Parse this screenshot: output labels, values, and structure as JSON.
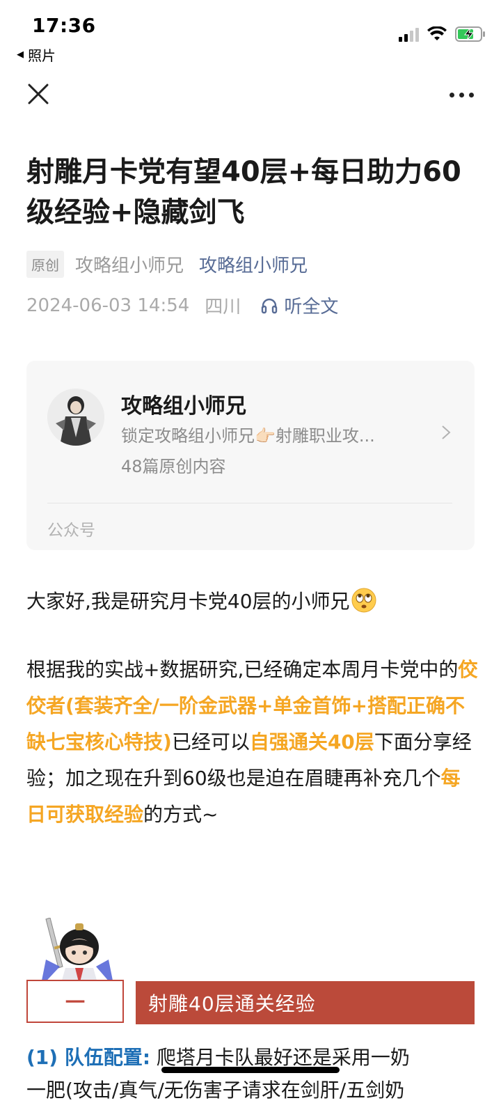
{
  "status_bar": {
    "time": "17:36",
    "back_app": "照片",
    "back_icon": "back-triangle-icon",
    "icons": [
      "signal-icon",
      "wifi-icon",
      "battery-charging-icon"
    ],
    "battery_color": "#34c759"
  },
  "nav": {
    "close_icon": "close-icon",
    "more_icon": "more-icon"
  },
  "article": {
    "title": "射雕月卡党有望40层+每日助力60级经验+隐藏剑飞",
    "original_tag": "原创",
    "author": "攻略组小师兄",
    "account_link": "攻略组小师兄",
    "date": "2024-06-03 14:54",
    "location": "四川",
    "listen_label": "听全文"
  },
  "account_card": {
    "name": "攻略组小师兄",
    "description": "锁定攻略组小师兄👉🏻射雕职业攻...",
    "count": "48篇原创内容",
    "footer": "公众号"
  },
  "body": {
    "p1": "大家好,我是研究月卡党40层的小师兄",
    "p2_a": "根据我的实战+数据研究,已经确定本周月卡党中的",
    "p2_hl1": "佼佼者(套装齐全/一阶金武器+单金首饰+搭配正确不缺七宝核心特技)",
    "p2_b": "已经可以",
    "p2_hl2": "自强通关40层",
    "p2_c": "下面分享经验；加之现在升到60级也是迫在眉睫再补充几个",
    "p2_hl3": "每日可获取经验",
    "p2_d": "的方式~",
    "section_number": "一",
    "section_title": "射雕40层通关经验",
    "p3_label": "(1) 队伍配置:",
    "p3_text": " 爬塔月卡队最好还是采用一奶",
    "p4_text": "一肥(攻击/真气/无伤害子请求在剑肝/五剑奶"
  },
  "colors": {
    "highlight": "#f5a623",
    "link": "#576b95",
    "section": "#bb4a3a",
    "label_blue": "#1e6fb6"
  }
}
